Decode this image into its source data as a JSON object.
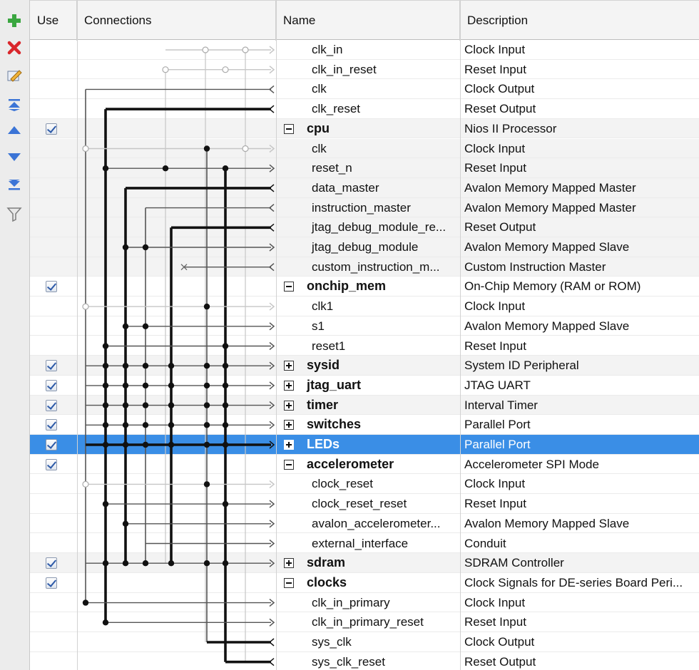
{
  "toolbar": {
    "buttons": [
      {
        "name": "add-icon"
      },
      {
        "name": "remove-icon"
      },
      {
        "name": "edit-icon"
      },
      {
        "name": "move-top-icon"
      },
      {
        "name": "move-up-icon"
      },
      {
        "name": "move-down-icon"
      },
      {
        "name": "move-bottom-icon"
      },
      {
        "name": "filter-icon"
      }
    ],
    "colors": {
      "add": "#3aa640",
      "remove": "#d9262b",
      "arrows": "#3b74d6",
      "filter": "#7d7d7d"
    }
  },
  "header": {
    "use": "Use",
    "connections": "Connections",
    "name": "Name",
    "description": "Description"
  },
  "colors": {
    "selection": "#3a8ee6",
    "wire_bold": "#111111",
    "wire_thin": "#555555",
    "wire_dim": "#c6c6c6"
  },
  "rows": [
    {
      "name": "clk_in",
      "desc": "Clock Input",
      "level": "child"
    },
    {
      "name": "clk_in_reset",
      "desc": "Reset Input",
      "level": "child"
    },
    {
      "name": "clk",
      "desc": "Clock Output",
      "level": "child"
    },
    {
      "name": "clk_reset",
      "desc": "Reset Output",
      "level": "child"
    },
    {
      "name": "cpu",
      "desc": "Nios II Processor",
      "level": "parent",
      "expanded": true,
      "checked": true
    },
    {
      "name": "clk",
      "desc": "Clock Input",
      "level": "child"
    },
    {
      "name": "reset_n",
      "desc": "Reset Input",
      "level": "child"
    },
    {
      "name": "data_master",
      "desc": "Avalon Memory Mapped Master",
      "level": "child"
    },
    {
      "name": "instruction_master",
      "desc": "Avalon Memory Mapped Master",
      "level": "child"
    },
    {
      "name": "jtag_debug_module_re...",
      "desc": "Reset Output",
      "level": "child"
    },
    {
      "name": "jtag_debug_module",
      "desc": "Avalon Memory Mapped Slave",
      "level": "child"
    },
    {
      "name": "custom_instruction_m...",
      "desc": "Custom Instruction Master",
      "level": "child"
    },
    {
      "name": "onchip_mem",
      "desc": "On-Chip Memory (RAM or ROM)",
      "level": "parent",
      "expanded": true,
      "checked": true
    },
    {
      "name": "clk1",
      "desc": "Clock Input",
      "level": "child"
    },
    {
      "name": "s1",
      "desc": "Avalon Memory Mapped Slave",
      "level": "child"
    },
    {
      "name": "reset1",
      "desc": "Reset Input",
      "level": "child"
    },
    {
      "name": "sysid",
      "desc": "System ID Peripheral",
      "level": "parent",
      "expanded": false,
      "checked": true
    },
    {
      "name": "jtag_uart",
      "desc": "JTAG UART",
      "level": "parent",
      "expanded": false,
      "checked": true
    },
    {
      "name": "timer",
      "desc": "Interval Timer",
      "level": "parent",
      "expanded": false,
      "checked": true
    },
    {
      "name": "switches",
      "desc": "Parallel Port",
      "level": "parent",
      "expanded": false,
      "checked": true
    },
    {
      "name": "LEDs",
      "desc": "Parallel Port",
      "level": "parent",
      "expanded": false,
      "checked": true,
      "selected": true
    },
    {
      "name": "accelerometer",
      "desc": "Accelerometer SPI Mode",
      "level": "parent",
      "expanded": true,
      "checked": true
    },
    {
      "name": "clock_reset",
      "desc": "Clock Input",
      "level": "child"
    },
    {
      "name": "clock_reset_reset",
      "desc": "Reset Input",
      "level": "child"
    },
    {
      "name": "avalon_accelerometer...",
      "desc": "Avalon Memory Mapped Slave",
      "level": "child"
    },
    {
      "name": "external_interface",
      "desc": "Conduit",
      "level": "child"
    },
    {
      "name": "sdram",
      "desc": "SDRAM Controller",
      "level": "parent",
      "expanded": false,
      "checked": true
    },
    {
      "name": "clocks",
      "desc": "Clock Signals for DE-series Board Peri...",
      "level": "parent",
      "expanded": true,
      "checked": true
    },
    {
      "name": "clk_in_primary",
      "desc": "Clock Input",
      "level": "child"
    },
    {
      "name": "clk_in_primary_reset",
      "desc": "Reset Input",
      "level": "child"
    },
    {
      "name": "sys_clk",
      "desc": "Clock Output",
      "level": "child"
    },
    {
      "name": "sys_clk_reset",
      "desc": "Reset Output",
      "level": "child"
    }
  ]
}
